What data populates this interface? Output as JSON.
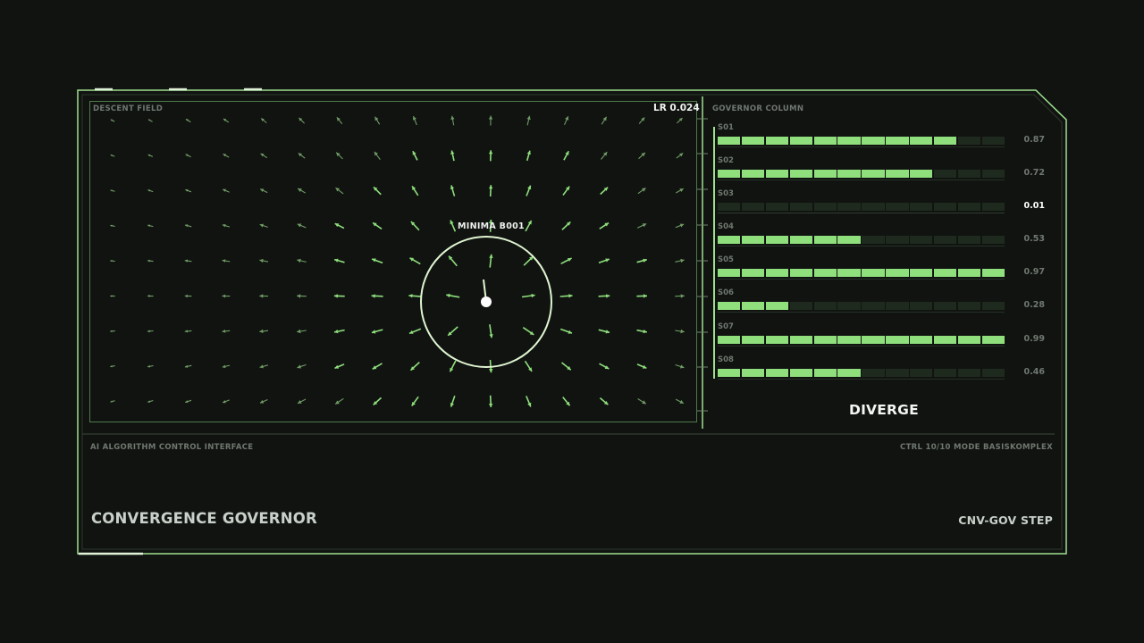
{
  "field": {
    "label": "DESCENT FIELD",
    "lr_value": "LR 0.024",
    "minima_label": "MINIMA B001"
  },
  "governor": {
    "label": "GOVERNOR COLUMN",
    "active_slot": "S03",
    "slots": [
      {
        "name": "S01",
        "value": "0.87",
        "level": 0.87
      },
      {
        "name": "S02",
        "value": "0.72",
        "level": 0.72
      },
      {
        "name": "S03",
        "value": "0.01",
        "level": 0.01
      },
      {
        "name": "S04",
        "value": "0.53",
        "level": 0.53
      },
      {
        "name": "S05",
        "value": "0.97",
        "level": 0.97
      },
      {
        "name": "S06",
        "value": "0.28",
        "level": 0.28
      },
      {
        "name": "S07",
        "value": "0.99",
        "level": 0.99
      },
      {
        "name": "S08",
        "value": "0.46",
        "level": 0.46
      }
    ],
    "state": "DIVERGE"
  },
  "footer": {
    "left": "AI ALGORITHM CONTROL INTERFACE",
    "right": "CTRL 10/10 MODE BASISKOMPLEX"
  },
  "title": "CONVERGENCE GOVERNOR",
  "code": "CNV-GOV  STEP",
  "colors": {
    "accent": "#8fe07c",
    "frame": "#9fe08f",
    "background": "#111311",
    "inactive": "#1f2a1f"
  }
}
